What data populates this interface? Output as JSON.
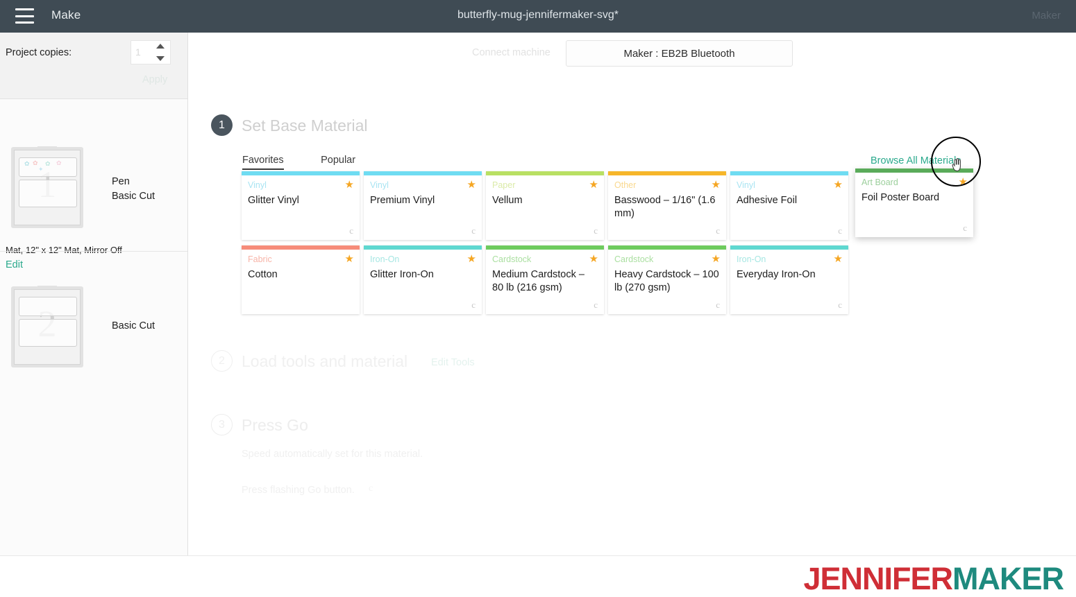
{
  "topbar": {
    "menu_icon": "hamburger-icon",
    "app_label": "Make",
    "document_title": "butterfly-mug-jennifermaker-svg*",
    "machine_label": "Maker"
  },
  "sidebar": {
    "copies": {
      "label": "Project copies:",
      "value": "1",
      "apply_label": "Apply"
    },
    "mats": [
      {
        "number": "1",
        "operations": "Pen\nBasic Cut",
        "op_lines": [
          "Pen",
          "Basic Cut"
        ],
        "meta": "Mat, 12\" x 12\" Mat, Mirror Off",
        "edit_label": "Edit"
      },
      {
        "number": "2",
        "op_lines": [
          "Basic Cut"
        ]
      }
    ]
  },
  "main": {
    "connect": {
      "label": "Connect machine",
      "machine_button": "Maker : EB2B Bluetooth"
    },
    "steps": [
      {
        "num": "1",
        "title": "Set Base Material"
      },
      {
        "num": "2",
        "title": "Load tools and material",
        "action": "Edit Tools"
      },
      {
        "num": "3",
        "title": "Press Go",
        "note1": "Speed automatically set for this material.",
        "note2": "Press flashing Go button."
      }
    ],
    "tabs": [
      {
        "label": "Favorites",
        "active": true
      },
      {
        "label": "Popular",
        "active": false
      }
    ],
    "browse_all_label": "Browse All Materials",
    "materials": [
      {
        "category": "Vinyl",
        "name": "Glitter Vinyl",
        "bar_color": "#6fdcf2",
        "cat_color": "#a9e4f2",
        "favorite": true,
        "cricut_mark": true,
        "hover": false
      },
      {
        "category": "Vinyl",
        "name": "Premium Vinyl",
        "bar_color": "#6fdcf2",
        "cat_color": "#a9e4f2",
        "favorite": true,
        "cricut_mark": true,
        "hover": false
      },
      {
        "category": "Paper",
        "name": "Vellum",
        "bar_color": "#b9e063",
        "cat_color": "#dbeba8",
        "favorite": true,
        "cricut_mark": true,
        "hover": false
      },
      {
        "category": "Other",
        "name": "Basswood – 1/16\" (1.6 mm)",
        "bar_color": "#f6b62a",
        "cat_color": "#f9d88e",
        "favorite": true,
        "cricut_mark": true,
        "hover": false
      },
      {
        "category": "Vinyl",
        "name": "Adhesive Foil",
        "bar_color": "#6fdcf2",
        "cat_color": "#a9e4f2",
        "favorite": true,
        "cricut_mark": true,
        "hover": false
      },
      {
        "category": "Art Board",
        "name": "Foil Poster Board",
        "bar_color": "#5aab5a",
        "cat_color": "#9ccf9c",
        "favorite": true,
        "cricut_mark": true,
        "hover": true
      },
      {
        "category": "Fabric",
        "name": "Cotton",
        "bar_color": "#f68c7a",
        "cat_color": "#f7b4a8",
        "favorite": true,
        "cricut_mark": false,
        "hover": false
      },
      {
        "category": "Iron-On",
        "name": "Glitter Iron-On",
        "bar_color": "#5fd8d0",
        "cat_color": "#a6e7e3",
        "favorite": true,
        "cricut_mark": true,
        "hover": false
      },
      {
        "category": "Cardstock",
        "name": "Medium Cardstock – 80 lb (216 gsm)",
        "bar_color": "#6ecb5e",
        "cat_color": "#aadfa0",
        "favorite": true,
        "cricut_mark": true,
        "hover": false
      },
      {
        "category": "Cardstock",
        "name": "Heavy Cardstock – 100 lb (270 gsm)",
        "bar_color": "#6ecb5e",
        "cat_color": "#aadfa0",
        "favorite": true,
        "cricut_mark": true,
        "hover": false
      },
      {
        "category": "Iron-On",
        "name": "Everyday Iron-On",
        "bar_color": "#5fd8d0",
        "cat_color": "#a6e7e3",
        "favorite": true,
        "cricut_mark": true,
        "hover": false
      }
    ],
    "star_glyph": "★",
    "cricut_glyph": "c"
  },
  "footer": {
    "logo_part1": "JENNIFER",
    "logo_part2": "MAKER"
  },
  "colors": {
    "topbar_bg": "#3f4b54",
    "accent_green": "#2aa98c",
    "star": "#f5a623",
    "logo_red": "#cf2e36",
    "logo_teal": "#1e8a7e"
  }
}
